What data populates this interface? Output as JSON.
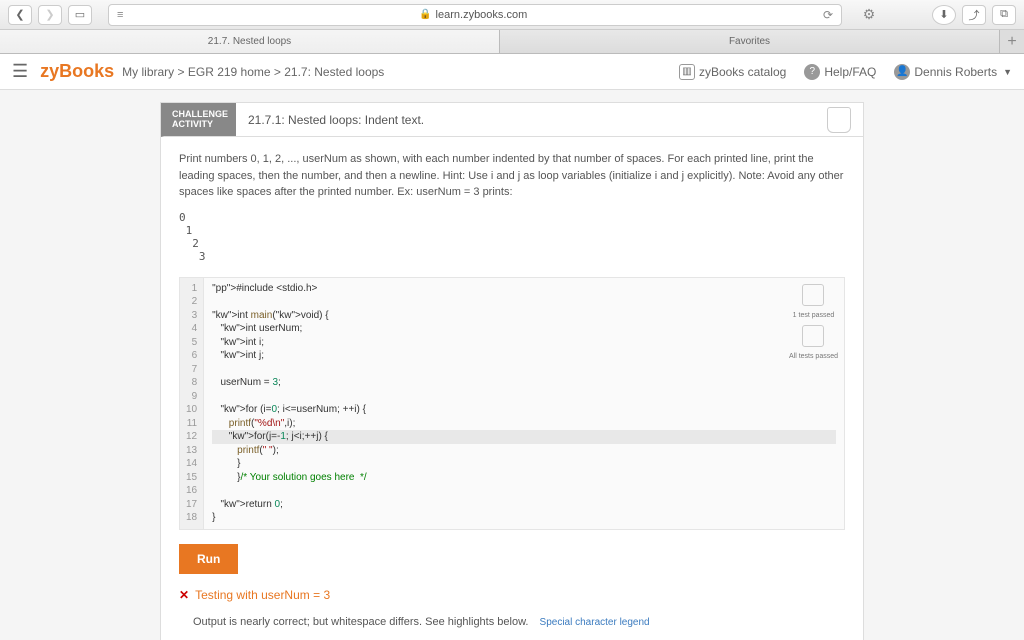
{
  "browser": {
    "url": "learn.zybooks.com",
    "tab_active": "21.7. Nested loops",
    "tab_favorites": "Favorites"
  },
  "header": {
    "logo": "zyBooks",
    "breadcrumb": "My library > EGR 219 home > 21.7: Nested loops",
    "catalog": "zyBooks catalog",
    "help": "Help/FAQ",
    "user": "Dennis Roberts"
  },
  "activity": {
    "challenge_label1": "CHALLENGE",
    "challenge_label2": "ACTIVITY",
    "title": "21.7.1: Nested loops: Indent text.",
    "prompt": "Print numbers 0, 1, 2, ..., userNum as shown, with each number indented by that number of spaces. For each printed line, print the leading spaces, then the number, and then a newline. Hint: Use i and j as loop variables (initialize i and j explicitly). Note: Avoid any other spaces like spaces after the printed number. Ex: userNum = 3 prints:",
    "example": "0\n 1\n  2\n   3",
    "badge1": "1 test\npassed",
    "badge2": "All tests\npassed"
  },
  "code": {
    "lines": [
      {
        "n": "1",
        "raw": "#include <stdio.h>",
        "cls": "pp"
      },
      {
        "n": "2",
        "raw": ""
      },
      {
        "n": "3",
        "raw": "int main(void) {"
      },
      {
        "n": "4",
        "raw": "   int userNum;"
      },
      {
        "n": "5",
        "raw": "   int i;"
      },
      {
        "n": "6",
        "raw": "   int j;"
      },
      {
        "n": "7",
        "raw": ""
      },
      {
        "n": "8",
        "raw": "   userNum = 3;"
      },
      {
        "n": "9",
        "raw": ""
      },
      {
        "n": "10",
        "raw": "   for (i=0; i<=userNum; ++i) {"
      },
      {
        "n": "11",
        "raw": "      printf(\"%d\\n\",i);"
      },
      {
        "n": "12",
        "raw": "      for(j=-1; j<i;++j) {",
        "hl": true
      },
      {
        "n": "13",
        "raw": "         printf(\" \");"
      },
      {
        "n": "14",
        "raw": "         }"
      },
      {
        "n": "15",
        "raw": "         }/* Your solution goes here  */"
      },
      {
        "n": "16",
        "raw": ""
      },
      {
        "n": "17",
        "raw": "   return 0;"
      },
      {
        "n": "18",
        "raw": "}"
      }
    ]
  },
  "run": {
    "button": "Run",
    "test_line": "Testing with userNum = 3",
    "output_msg": "Output is nearly correct; but whitespace differs. See highlights below.",
    "legend": "Special character legend"
  }
}
